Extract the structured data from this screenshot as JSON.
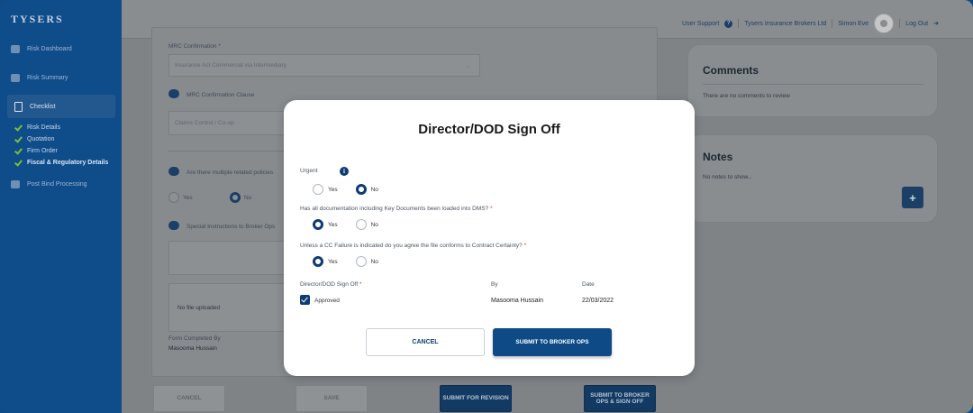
{
  "app": {
    "logo_text": "TYSERS"
  },
  "sidebar": {
    "items": [
      {
        "label": "Risk Dashboard",
        "icon": "dashboard-icon"
      },
      {
        "label": "Risk Summary",
        "icon": "summary-icon"
      },
      {
        "label": "Checklist",
        "icon": "checklist-icon",
        "active": true
      },
      {
        "label": "Post Bind Processing",
        "icon": "edit-icon"
      }
    ],
    "checklist_subitems": [
      {
        "label": "Risk Details",
        "done": true
      },
      {
        "label": "Quotation",
        "done": true
      },
      {
        "label": "Firm Order",
        "done": true
      },
      {
        "label": "Fiscal & Regulatory Details",
        "done": true,
        "current": true
      }
    ]
  },
  "header": {
    "user_support": "User Support",
    "company": "Tysers Insurance Brokers Ltd",
    "user_name": "Simon Eve",
    "logout": "Log Out"
  },
  "form": {
    "mrc_confirmation_label": "MRC Confirmation *",
    "mrc_confirmation_value": "Insurance Act Commercial via Intermediary",
    "mrc_clause_label": "MRC Confirmation Clause",
    "mrc_clause_placeholder": "Claims Control / Co-op",
    "multiple_policies_label": "Are there multiple related policies",
    "yes": "Yes",
    "no": "No",
    "special_instructions_label": "Special Instructions to Broker Ops",
    "no_file": "No file uploaded",
    "form_completed_by_label": "Form Completed By",
    "form_completed_by_value": "Masooma Hussain"
  },
  "comments": {
    "title": "Comments",
    "empty_text": "There are no comments to review"
  },
  "notes": {
    "title": "Notes",
    "empty_text": "No notes to show...",
    "add_label": "+"
  },
  "bottom_actions": {
    "cancel": "CANCEL",
    "save": "SAVE",
    "submit_revision": "SUBMIT FOR REVISION",
    "submit_signoff": "SUBMIT TO BROKER OPS & SIGN OFF"
  },
  "modal": {
    "title": "Director/DOD Sign Off",
    "urgent_label": "Urgent",
    "urgent_value": "No",
    "q1_label": "Has all documentation including Key Documents been loaded into DMS?",
    "q1_value": "Yes",
    "q2_label": "Unless a CC Failure is indicated do you agree the file conforms to Contract Certainty?",
    "q2_value": "Yes",
    "yes": "Yes",
    "no": "No",
    "required_marker": "*",
    "signoff_col": "Director/DOD Sign Off",
    "by_col": "By",
    "date_col": "Date",
    "approved_label": "Approved",
    "by_value": "Masooma Hussain",
    "date_value": "22/03/2022",
    "cancel": "CANCEL",
    "submit": "SUBMIT TO BROKER OPS"
  },
  "colors": {
    "brand": "#0d4a86",
    "overlay_bg": "#7f8386",
    "check_green": "#7bbf3a",
    "required": "#d9342b"
  }
}
